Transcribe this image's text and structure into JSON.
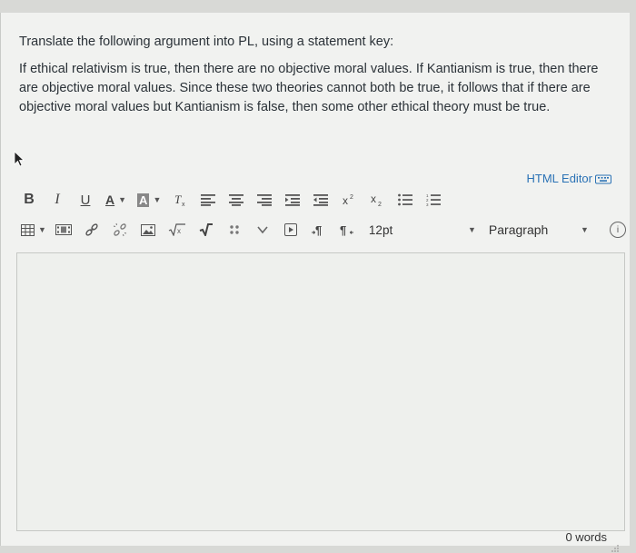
{
  "question": {
    "prompt": "Translate the following argument into PL, using a statement key:",
    "body": "If ethical relativism is true, then there are no objective moral values. If Kantianism is true, then there are objective moral values. Since these two theories cannot both be true, it follows that if there are objective moral values but Kantianism is false, then some other ethical theory must be true."
  },
  "editor": {
    "html_editor_label": "HTML Editor",
    "font_size": "12pt",
    "block_format": "Paragraph",
    "word_count": "0 words",
    "toolbar_row1": [
      "B",
      "I",
      "U",
      "A",
      "A"
    ],
    "accent_color": "#2a72b5"
  }
}
